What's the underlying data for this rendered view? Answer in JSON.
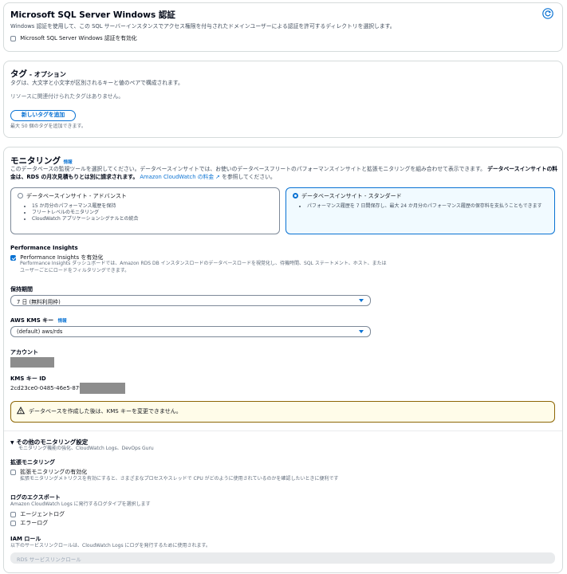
{
  "windows_auth": {
    "title": "Microsoft SQL Server Windows 認証",
    "description": "Windows 認証を使用して、この SQL サーバーインスタンスでアクセス権限を付与されたドメインユーザーによる認証を許可するディレクトリを選択します。",
    "checkbox_label": "Microsoft SQL Server Windows 認証を有効化"
  },
  "tags": {
    "title": "タグ",
    "title_suffix": " - オプション",
    "description": "タグは、大文字と小文字が区別されるキーと値のペアで構成されます。",
    "empty_text": "リソースに関連付けられたタグはありません。",
    "add_button": "新しいタグを追加",
    "limit_text": "最大 50 個のタグを追加できます。"
  },
  "monitoring": {
    "title": "モニタリング",
    "info_link": "情報",
    "description_1": "このデータベースの監視ツールを選択してください。データベースインサイトでは、お使いのデータベースフリートのパフォーマンスインサイトと拡張モニタリングを組み合わせて表示できます。",
    "description_bold": "データベースインサイトの料金は、RDS の月次見積もりとは別に請求されます。",
    "link_text": "Amazon CloudWatch の料金",
    "description_2": "を参照してください。",
    "options": [
      {
        "label": "データベースインサイト - アドバンスト",
        "bullets": [
          "15 か月分のパフォーマンス履歴を保持",
          "フリートレベルのモニタリング",
          "CloudWatch アプリケーションシグナルとの統合"
        ]
      },
      {
        "label": "データベースインサイト - スタンダード",
        "bullets": [
          "パフォーマンス履歴を 7 日間保存し、最大 24 か月分のパフォーマンス履歴の保存料を支払うこともできます"
        ]
      }
    ],
    "pi_heading": "Performance Insights",
    "pi_checkbox": "Performance Insights を有効化",
    "pi_desc": "Performance Insights ダッシュボードでは、Amazon RDS DB インスタンスロードのデータベースロードを視覚化し、待機時間、SQL ステートメント、ホスト、またはユーザーごとにロードをフィルタリングできます。",
    "retention_label": "保持期間",
    "retention_value": "7 日 (無料利用枠)",
    "kms_label": "AWS KMS キー",
    "kms_info": "情報",
    "kms_value": "(default) aws/rds",
    "account_label": "アカウント",
    "kms_id_label": "KMS キー ID",
    "kms_id_value": "2cd23ce0-0485-46e5-879",
    "warning": "データベースを作成した後は、KMS キーを変更できません。",
    "other_title": "その他のモニタリング設定",
    "other_desc": "モニタリング機能の強化、CloudWatch Logs、DevOps Guru",
    "enhanced_label": "拡張モニタリング",
    "enhanced_checkbox": "拡張モニタリングの有効化",
    "enhanced_desc": "拡張モニタリングメトリクスを有効にすると、さまざまなプロセスやスレッドで CPU がどのように使用されているのかを確認したいときに便利です",
    "log_export_label": "ログのエクスポート",
    "log_export_desc": "Amazon CloudWatch Logs に発行するログタイプを選択します",
    "log_agent": "エージェントログ",
    "log_error": "エラーログ",
    "iam_label": "IAM ロール",
    "iam_desc": "以下のサービスリンクロールは、CloudWatch Logs にログを発行するために使用されます。",
    "iam_placeholder": "RDS サービスリンクロール"
  },
  "colors": {
    "accent": "#0972d3",
    "warning_border": "#8d6605",
    "warning_bg": "#fffce9"
  }
}
